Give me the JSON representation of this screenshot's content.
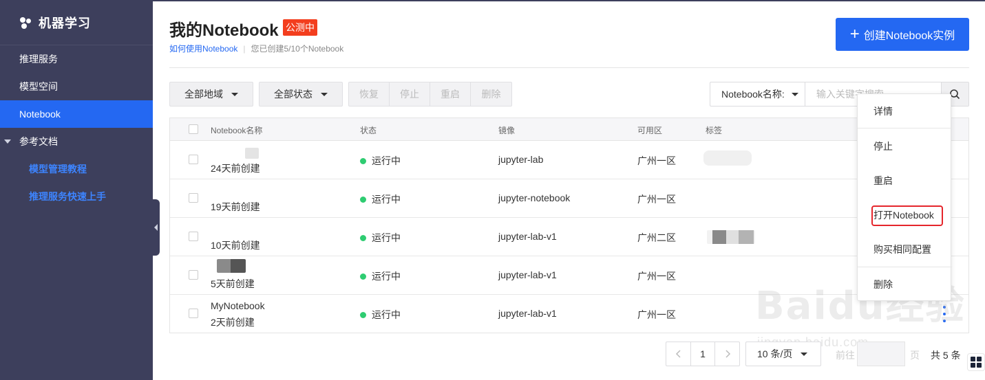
{
  "sidebar": {
    "brand": "机器学习",
    "items": [
      {
        "label": "推理服务"
      },
      {
        "label": "模型空间"
      },
      {
        "label": "Notebook"
      }
    ],
    "group": {
      "label": "参考文档",
      "children": [
        {
          "label": "模型管理教程"
        },
        {
          "label": "推理服务快速上手"
        }
      ]
    }
  },
  "header": {
    "title": "我的Notebook",
    "badge": "公测中",
    "help_link": "如何使用Notebook",
    "quota_info": "您已创建5/10个Notebook",
    "create_button": "创建Notebook实例"
  },
  "toolbar": {
    "region_filter": "全部地域",
    "status_filter": "全部状态",
    "actions": [
      "恢复",
      "停止",
      "重启",
      "删除"
    ],
    "search_field": "Notebook名称:",
    "search_placeholder": "输入关键字搜索"
  },
  "table": {
    "columns": [
      "Notebook名称",
      "状态",
      "镜像",
      "可用区",
      "标签"
    ],
    "rows": [
      {
        "name": "",
        "created": "24天前创建",
        "status": "运行中",
        "image": "jupyter-lab",
        "zone": "广州一区"
      },
      {
        "name": "",
        "created": "19天前创建",
        "status": "运行中",
        "image": "jupyter-notebook",
        "zone": "广州一区"
      },
      {
        "name": "",
        "created": "10天前创建",
        "status": "运行中",
        "image": "jupyter-lab-v1",
        "zone": "广州二区"
      },
      {
        "name": "",
        "created": "5天前创建",
        "status": "运行中",
        "image": "jupyter-lab-v1",
        "zone": "广州一区"
      },
      {
        "name": "MyNotebook",
        "created": "2天前创建",
        "status": "运行中",
        "image": "jupyter-lab-v1",
        "zone": "广州一区"
      }
    ]
  },
  "context_menu": {
    "items": [
      "详情",
      "停止",
      "重启",
      "打开Notebook",
      "购买相同配置",
      "删除"
    ]
  },
  "pagination": {
    "current_page": "1",
    "page_size": "10 条/页",
    "goto_label": "前往",
    "goto_unit": "页",
    "total": "共 5 条"
  },
  "watermark": {
    "text": "Baidu经验",
    "url": "jingyan.baidu.com"
  },
  "colors": {
    "sidebar_bg": "#3d3f5c",
    "accent": "#2468f2",
    "badge": "#f33e1e",
    "status_running": "#2ecc71",
    "highlight_box": "#e5252b"
  }
}
